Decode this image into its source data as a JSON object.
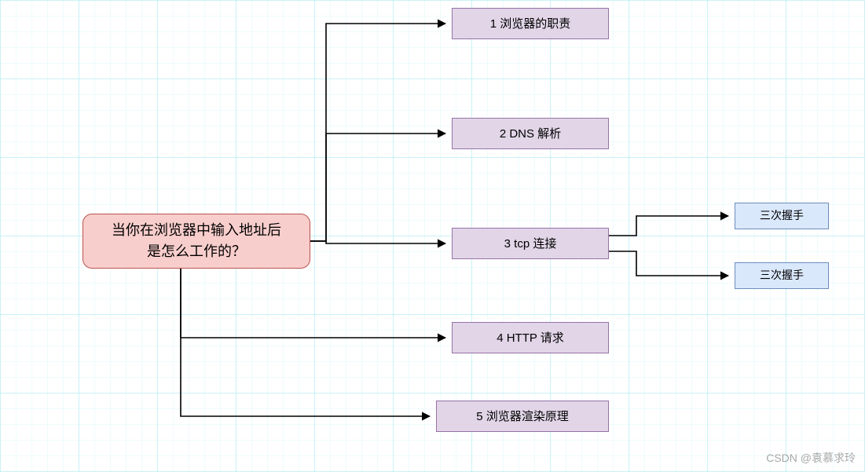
{
  "root": {
    "text": "当你在浏览器中输入地址后\n是怎么工作的？"
  },
  "mids": [
    {
      "text": "1 浏览器的职责"
    },
    {
      "text": "2 DNS 解析"
    },
    {
      "text": "3 tcp 连接"
    },
    {
      "text": "4 HTTP 请求"
    },
    {
      "text": "5 浏览器渲染原理"
    }
  ],
  "leaves": [
    {
      "text": "三次握手"
    },
    {
      "text": "三次握手"
    }
  ],
  "watermark": "CSDN @袁慕求玲"
}
